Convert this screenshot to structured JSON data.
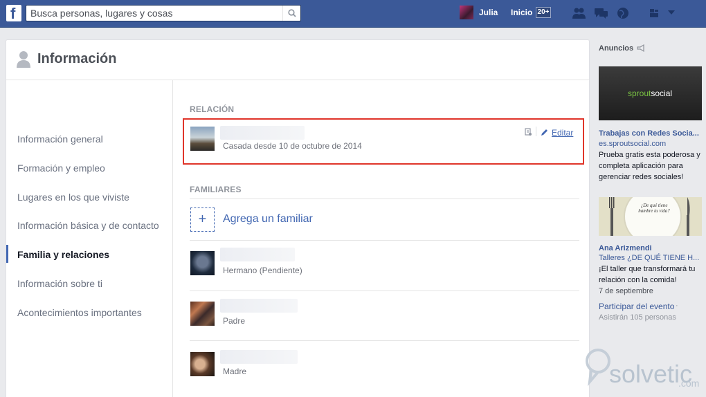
{
  "topbar": {
    "logo": "f",
    "search_placeholder": "Busca personas, lugares y cosas",
    "user_name": "Julia",
    "home_label": "Inicio",
    "home_badge": "20+"
  },
  "card": {
    "title": "Información"
  },
  "sidebar": {
    "items": [
      {
        "label": "Información general"
      },
      {
        "label": "Formación y empleo"
      },
      {
        "label": "Lugares en los que viviste"
      },
      {
        "label": "Información básica y de contacto"
      },
      {
        "label": "Familia y relaciones"
      },
      {
        "label": "Información sobre ti"
      },
      {
        "label": "Acontecimientos importantes"
      }
    ],
    "active_index": 4
  },
  "relationship": {
    "section_title": "RELACIÓN",
    "status": "Casada desde 10 de octubre de 2014",
    "edit_label": "Editar"
  },
  "family": {
    "section_title": "FAMILIARES",
    "add_label": "Agrega un familiar",
    "add_symbol": "+",
    "members": [
      {
        "relation": "Hermano (Pendiente)"
      },
      {
        "relation": "Padre"
      },
      {
        "relation": "Madre"
      }
    ]
  },
  "ads": {
    "title": "Anuncios",
    "ad1": {
      "image_text_brand": "sprout",
      "image_text_rest": "social",
      "headline": "Trabajas con Redes Socia...",
      "url": "es.sproutsocial.com",
      "lines": [
        "Prueba gratis esta poderosa y",
        "completa aplicación para",
        "gerenciar redes sociales!"
      ]
    },
    "ad2": {
      "plate_text": "¿De qué tiene hambre tu vida?",
      "headline": "Ana Arizmendi",
      "subtitle": "Talleres ¿DE QUÉ TIENE H...",
      "lines": [
        "¡El taller que transformará tu",
        "relación con la comida!",
        "7 de septiembre"
      ],
      "action": "Participar del evento",
      "action_sep": "·",
      "attendees": "Asistirán 105 personas"
    }
  },
  "watermark": {
    "word": "solvetic",
    "suffix": ".com"
  },
  "colors": {
    "topbar": "#3b5998",
    "link": "#4267b2",
    "highlight_border": "#e0352a"
  }
}
